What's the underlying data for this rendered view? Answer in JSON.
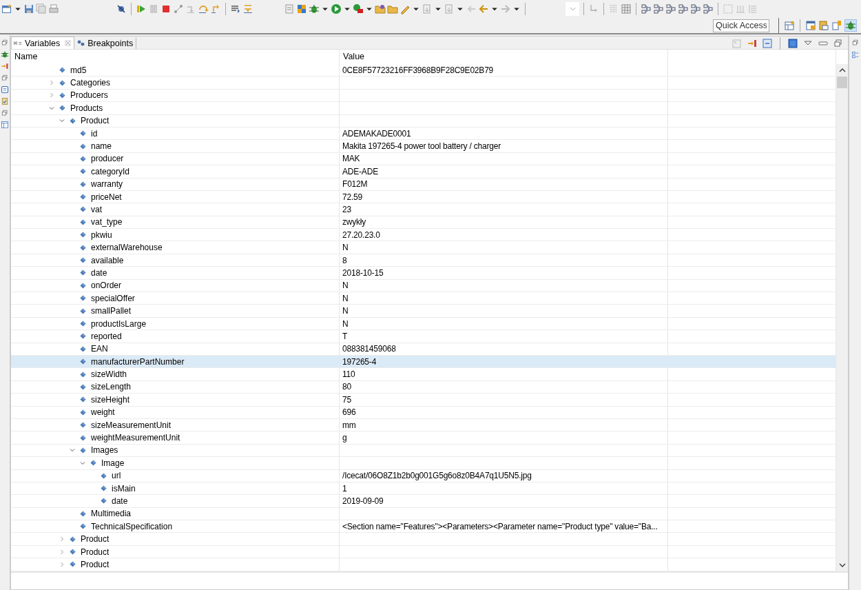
{
  "toolbar": {
    "quick_access": {
      "placeholder": "Quick Access"
    }
  },
  "tabs": [
    {
      "label": "Variables",
      "selected": true,
      "closable": true
    },
    {
      "label": "Breakpoints",
      "selected": false,
      "closable": false
    }
  ],
  "columns": [
    "Name",
    "Value"
  ],
  "tree": [
    {
      "name": "md5",
      "value": "0CE8F57723216FF3968B9F28C9E02B79",
      "selected": false
    },
    {
      "name": "Categories",
      "expanded": false,
      "selected": false
    },
    {
      "name": "Producers",
      "expanded": false,
      "selected": false
    },
    {
      "name": "Products",
      "expanded": true,
      "selected": false,
      "children": [
        {
          "name": "Product",
          "expanded": true,
          "selected": false,
          "children": [
            {
              "name": "id",
              "value": "ADEMAKADE0001",
              "selected": false
            },
            {
              "name": "name",
              "value": "Makita 197265-4 power tool battery / charger",
              "selected": false
            },
            {
              "name": "producer",
              "value": "MAK",
              "selected": false
            },
            {
              "name": "categoryId",
              "value": "ADE-ADE",
              "selected": false
            },
            {
              "name": "warranty",
              "value": "F012M",
              "selected": false
            },
            {
              "name": "priceNet",
              "value": "72.59",
              "selected": false
            },
            {
              "name": "vat",
              "value": "23",
              "selected": false
            },
            {
              "name": "vat_type",
              "value": "zwykły",
              "selected": false
            },
            {
              "name": "pkwiu",
              "value": "27.20.23.0",
              "selected": false
            },
            {
              "name": "externalWarehouse",
              "value": "N",
              "selected": false
            },
            {
              "name": "available",
              "value": "8",
              "selected": false
            },
            {
              "name": "date",
              "value": "2018-10-15",
              "selected": false
            },
            {
              "name": "onOrder",
              "value": "N",
              "selected": false
            },
            {
              "name": "specialOffer",
              "value": "N",
              "selected": false
            },
            {
              "name": "smallPallet",
              "value": "N",
              "selected": false
            },
            {
              "name": "productIsLarge",
              "value": "N",
              "selected": false
            },
            {
              "name": "reported",
              "value": "T",
              "selected": false
            },
            {
              "name": "EAN",
              "value": "088381459068",
              "selected": false
            },
            {
              "name": "manufacturerPartNumber",
              "value": "197265-4",
              "selected": true
            },
            {
              "name": "sizeWidth",
              "value": "110",
              "selected": false
            },
            {
              "name": "sizeLength",
              "value": "80",
              "selected": false
            },
            {
              "name": "sizeHeight",
              "value": "75",
              "selected": false
            },
            {
              "name": "weight",
              "value": "696",
              "selected": false
            },
            {
              "name": "sizeMeasurementUnit",
              "value": "mm",
              "selected": false
            },
            {
              "name": "weightMeasurementUnit",
              "value": "g",
              "selected": false
            },
            {
              "name": "Images",
              "expanded": true,
              "selected": false,
              "children": [
                {
                  "name": "Image",
                  "expanded": true,
                  "selected": false,
                  "children": [
                    {
                      "name": "url",
                      "value": "/Icecat/06O8Z1b2b0g001G5g6o8z0B4A7q1U5N5.jpg",
                      "selected": false
                    },
                    {
                      "name": "isMain",
                      "value": "1",
                      "selected": false
                    },
                    {
                      "name": "date",
                      "value": "2019-09-09",
                      "selected": false
                    }
                  ]
                }
              ]
            },
            {
              "name": "Multimedia",
              "selected": false
            },
            {
              "name": "TechnicalSpecification",
              "value": "<Section name=\"Features\"><Parameters><Parameter name=\"Product type\" value=\"Ba...",
              "selected": false
            }
          ]
        },
        {
          "name": "Product",
          "expanded": false,
          "selected": false
        },
        {
          "name": "Product",
          "expanded": false,
          "selected": false
        },
        {
          "name": "Product",
          "expanded": false,
          "selected": false
        }
      ]
    }
  ]
}
